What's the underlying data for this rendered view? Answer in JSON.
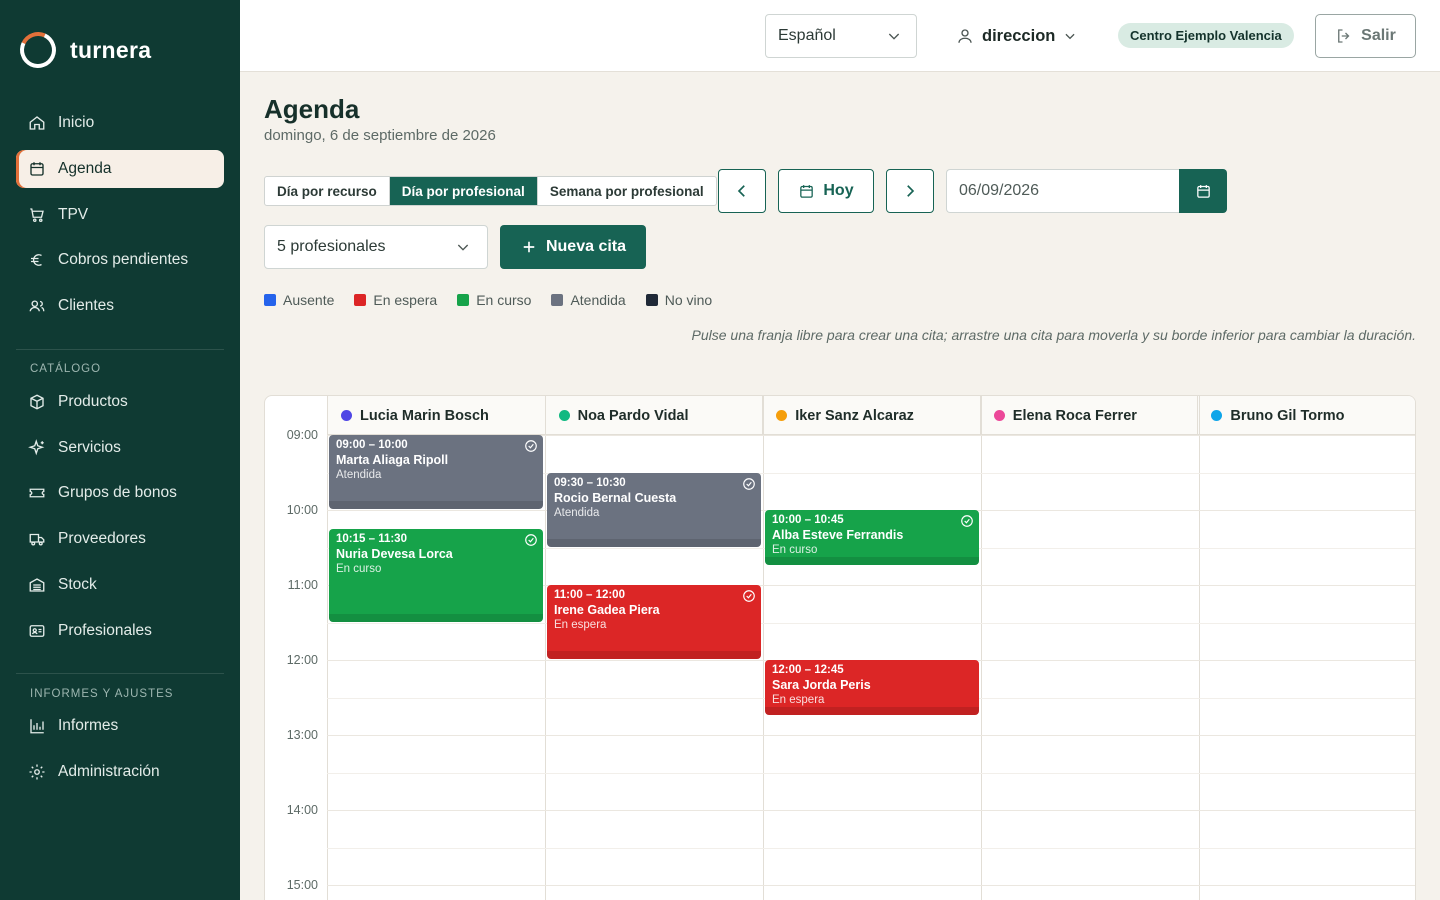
{
  "brand": {
    "name": "turnera"
  },
  "sidebar": {
    "items": [
      {
        "label": "Inicio",
        "icon": "home-icon"
      },
      {
        "label": "Agenda",
        "icon": "calendar-icon",
        "active": true
      },
      {
        "label": "TPV",
        "icon": "cart-icon"
      },
      {
        "label": "Cobros pendientes",
        "icon": "euro-icon"
      },
      {
        "label": "Clientes",
        "icon": "users-icon"
      }
    ],
    "catalog_label": "CATÁLOGO",
    "catalog_items": [
      {
        "label": "Productos",
        "icon": "box-icon"
      },
      {
        "label": "Servicios",
        "icon": "sparkle-icon"
      },
      {
        "label": "Grupos de bonos",
        "icon": "ticket-icon"
      },
      {
        "label": "Proveedores",
        "icon": "truck-icon"
      },
      {
        "label": "Stock",
        "icon": "warehouse-icon"
      },
      {
        "label": "Profesionales",
        "icon": "id-card-icon"
      }
    ],
    "reports_label": "INFORMES Y AJUSTES",
    "reports_items": [
      {
        "label": "Informes",
        "icon": "bar-chart-icon"
      },
      {
        "label": "Administración",
        "icon": "gear-icon"
      }
    ]
  },
  "header": {
    "language": "Español",
    "user": "direccion",
    "center": "Centro Ejemplo Valencia",
    "logout": "Salir"
  },
  "main": {
    "title": "Agenda",
    "date_text": "domingo, 6 de septiembre de 2026",
    "views": [
      "Día por recurso",
      "Día por profesional",
      "Semana por profesional"
    ],
    "active_view": "Día por profesional",
    "today_label": "Hoy",
    "date_value": "06/09/2026",
    "professionals_select": "5 profesionales",
    "new_button": "Nueva cita",
    "legend": [
      {
        "label": "Ausente",
        "color": "#2563eb"
      },
      {
        "label": "En espera",
        "color": "#dc2626"
      },
      {
        "label": "En curso",
        "color": "#16a34a"
      },
      {
        "label": "Atendida",
        "color": "#6b7280"
      },
      {
        "label": "No vino",
        "color": "#1f2937"
      }
    ],
    "hint": "Pulse una franja libre para crear una cita; arrastre una cita para moverla y su borde inferior para cambiar la duración."
  },
  "calendar": {
    "professionals": [
      {
        "name": "Lucia Marin Bosch",
        "color": "#4f46e5"
      },
      {
        "name": "Noa Pardo Vidal",
        "color": "#10b981"
      },
      {
        "name": "Iker Sanz Alcaraz",
        "color": "#f59e0b"
      },
      {
        "name": "Elena Roca Ferrer",
        "color": "#ec4899"
      },
      {
        "name": "Bruno Gil Tormo",
        "color": "#0ea5e9"
      }
    ],
    "hours": [
      "09:00",
      "10:00",
      "11:00",
      "12:00",
      "13:00",
      "14:00",
      "15:00"
    ],
    "appointments": [
      {
        "col": 0,
        "start": 9.0,
        "end": 10.0,
        "time": "09:00 – 10:00",
        "client": "Marta Aliaga Ripoll",
        "status": "Atendida",
        "color": "#6b7280",
        "check": true
      },
      {
        "col": 0,
        "start": 10.25,
        "end": 11.5,
        "time": "10:15 – 11:30",
        "client": "Nuria Devesa Lorca",
        "status": "En curso",
        "color": "#16a34a",
        "check": true
      },
      {
        "col": 1,
        "start": 9.5,
        "end": 10.5,
        "time": "09:30 – 10:30",
        "client": "Rocio Bernal Cuesta",
        "status": "Atendida",
        "color": "#6b7280",
        "check": true
      },
      {
        "col": 1,
        "start": 11.0,
        "end": 12.0,
        "time": "11:00 – 12:00",
        "client": "Irene Gadea Piera",
        "status": "En espera",
        "color": "#dc2626",
        "check": true
      },
      {
        "col": 2,
        "start": 10.0,
        "end": 10.75,
        "time": "10:00 – 10:45",
        "client": "Alba Esteve Ferrandis",
        "status": "En curso",
        "color": "#16a34a",
        "check": true
      },
      {
        "col": 2,
        "start": 12.0,
        "end": 12.75,
        "time": "12:00 – 12:45",
        "client": "Sara Jorda Peris",
        "status": "En espera",
        "color": "#dc2626",
        "check": false
      }
    ]
  }
}
